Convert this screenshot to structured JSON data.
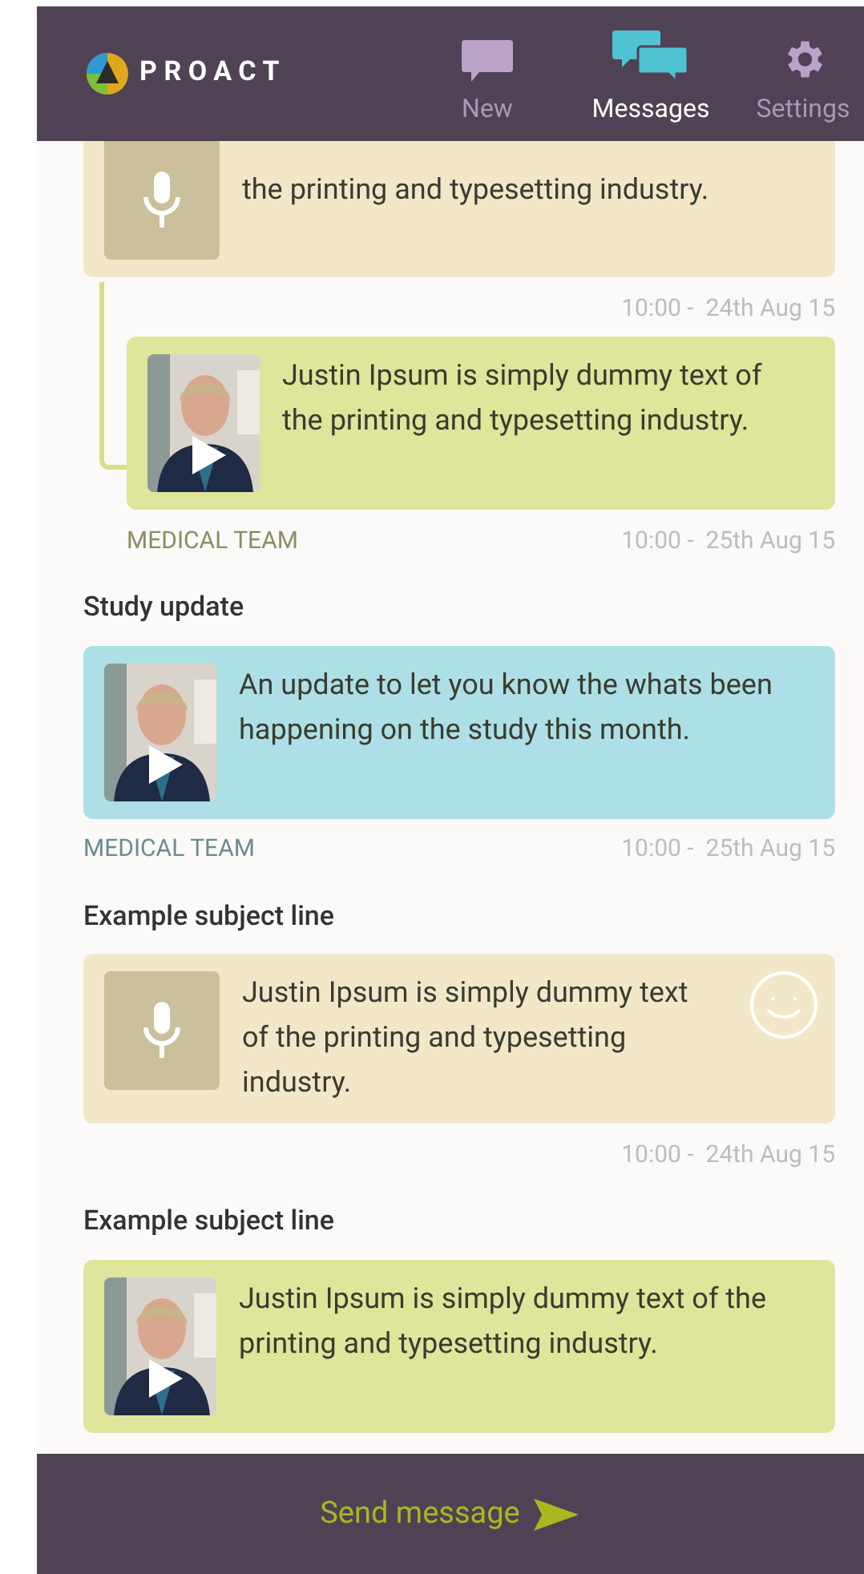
{
  "header": {
    "logo": "PROACT",
    "tabs": [
      {
        "kind": "new",
        "label": "New",
        "selected": false
      },
      {
        "kind": "messages",
        "label": "Messages",
        "selected": true
      },
      {
        "kind": "settings",
        "label": "Settings",
        "selected": false
      }
    ]
  },
  "messages": [
    {
      "kind": "voice",
      "color": "#f2e8c9",
      "cut_top": true,
      "smiley": false,
      "text": "the printing and typesetting industry.",
      "time": "10:00 -  24th Aug 15",
      "replies": [
        {
          "kind": "video",
          "color": "#dfe59a",
          "smiley": false,
          "text": "Justin Ipsum is simply dummy text of the printing and typesetting industry.",
          "sender": "MEDICAL TEAM",
          "time": "10:00 -  25th Aug 15"
        }
      ]
    },
    {
      "subject": "Study update",
      "kind": "video",
      "color": "#ade0e6",
      "smiley": false,
      "text": "An update to let you know the whats been happening on the study this month.",
      "sender": "MEDICAL TEAM",
      "time": "10:00 -  25th Aug 15"
    },
    {
      "subject": "Example subject line",
      "kind": "voice",
      "color": "#f2e8c9",
      "smiley": true,
      "text": "Justin Ipsum is simply dummy text of the printing and typesetting industry.",
      "time": "10:00 -  24th Aug 15"
    },
    {
      "subject": "Example subject line",
      "kind": "video",
      "color": "#dfe59a",
      "smiley": false,
      "text": "Justin Ipsum is simply dummy text of the printing and typesetting industry."
    }
  ],
  "footer": {
    "send_label": "Send message"
  }
}
